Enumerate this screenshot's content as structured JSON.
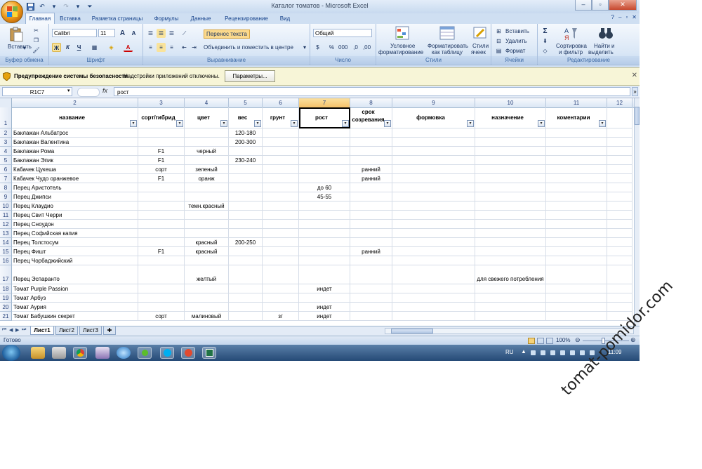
{
  "window": {
    "title": "Каталог томатов - Microsoft Excel",
    "controls": [
      "–",
      "▫",
      "✕"
    ]
  },
  "qat": {
    "items": [
      "save-icon",
      "undo-icon",
      "redo-icon",
      "customize-icon"
    ]
  },
  "tabs": [
    "Главная",
    "Вставка",
    "Разметка страницы",
    "Формулы",
    "Данные",
    "Рецензирование",
    "Вид"
  ],
  "tab_right": {
    "help": "?",
    "min": "–",
    "restore": "▫",
    "close": "✕"
  },
  "ribbon": {
    "clipboard": {
      "label": "Буфер обмена",
      "paste": "Вставить"
    },
    "font": {
      "label": "Шрифт",
      "name": "Calibri",
      "size": "11",
      "bold": "Ж",
      "italic": "К",
      "underline": "Ч",
      "grow": "A",
      "shrink": "A",
      "fontcolor": "A"
    },
    "alignment": {
      "label": "Выравнивание",
      "wrap": "Перенос текста",
      "merge": "Объединить и поместить в центре"
    },
    "number": {
      "label": "Число",
      "format": "Общий",
      "percent": "%",
      "thousands": "000",
      "inc": ",0",
      "dec": ",00"
    },
    "styles": {
      "label": "Стили",
      "conditional_1": "Условное",
      "conditional_2": "форматирование",
      "table_1": "Форматировать",
      "table_2": "как таблицу",
      "cell_1": "Стили",
      "cell_2": "ячеек"
    },
    "cells": {
      "label": "Ячейки",
      "insert": "Вставить",
      "delete": "Удалить",
      "format": "Формат"
    },
    "editing": {
      "label": "Редактирование",
      "sigma": "Σ",
      "sort_1": "Сортировка",
      "sort_2": "и фильтр",
      "find_1": "Найти и",
      "find_2": "выделить"
    }
  },
  "security": {
    "title": "Предупреждение системы безопасности",
    "message": "Надстройки приложений отключены.",
    "button": "Параметры...",
    "close": "✕"
  },
  "formula_bar": {
    "namebox": "R1C7",
    "fx": "fx",
    "value": "рост",
    "expand": "»"
  },
  "grid": {
    "columns": [
      "2",
      "3",
      "4",
      "5",
      "6",
      "7",
      "8",
      "9",
      "10",
      "11",
      "12"
    ],
    "header_row": [
      "название",
      "сорт/гибрид",
      "цвет",
      "вес",
      "грунт",
      "рост",
      "срок созревания",
      "формовка",
      "назначение",
      "коментарии",
      ""
    ],
    "rows": [
      {
        "n": "1"
      },
      {
        "n": "2",
        "cells": [
          "Баклажан Альбатрос",
          "",
          "",
          "120-180",
          "",
          "",
          "",
          "",
          "",
          "",
          ""
        ]
      },
      {
        "n": "3",
        "cells": [
          "Баклажан Валентина",
          "",
          "",
          "200-300",
          "",
          "",
          "",
          "",
          "",
          "",
          ""
        ]
      },
      {
        "n": "4",
        "cells": [
          "Баклажан Рома",
          "F1",
          "черный",
          "",
          "",
          "",
          "",
          "",
          "",
          "",
          ""
        ]
      },
      {
        "n": "5",
        "cells": [
          "Баклажан Эпик",
          "F1",
          "",
          "230-240",
          "",
          "",
          "",
          "",
          "",
          "",
          ""
        ]
      },
      {
        "n": "6",
        "cells": [
          "Кабачек Цукеша",
          "сорт",
          "зеленый",
          "",
          "",
          "",
          "ранний",
          "",
          "",
          "",
          ""
        ]
      },
      {
        "n": "7",
        "cells": [
          "Кабачек Чудо оранжевое",
          "F1",
          "оранж",
          "",
          "",
          "",
          "ранний",
          "",
          "",
          "",
          ""
        ]
      },
      {
        "n": "8",
        "cells": [
          "Перец Аристотель",
          "",
          "",
          "",
          "",
          "до 60",
          "",
          "",
          "",
          "",
          ""
        ]
      },
      {
        "n": "9",
        "cells": [
          "Перец Джипси",
          "",
          "",
          "",
          "",
          "45-55",
          "",
          "",
          "",
          "",
          ""
        ]
      },
      {
        "n": "10",
        "cells": [
          "Перец Клаудио",
          "",
          "темн.красный",
          "",
          "",
          "",
          "",
          "",
          "",
          "",
          ""
        ]
      },
      {
        "n": "11",
        "cells": [
          "Перец Свит Черри",
          "",
          "",
          "",
          "",
          "",
          "",
          "",
          "",
          "",
          ""
        ]
      },
      {
        "n": "12",
        "cells": [
          "Перец Сноудон",
          "",
          "",
          "",
          "",
          "",
          "",
          "",
          "",
          "",
          ""
        ]
      },
      {
        "n": "13",
        "cells": [
          "Перец Софийская капия",
          "",
          "",
          "",
          "",
          "",
          "",
          "",
          "",
          "",
          ""
        ]
      },
      {
        "n": "14",
        "cells": [
          "Перец Толстосум",
          "",
          "красный",
          "200-250",
          "",
          "",
          "",
          "",
          "",
          "",
          ""
        ]
      },
      {
        "n": "15",
        "cells": [
          "Перец Фишт",
          "F1",
          "красный",
          "",
          "",
          "",
          "ранний",
          "",
          "",
          "",
          ""
        ]
      },
      {
        "n": "16",
        "cells": [
          "Перец Чорбаджийский",
          "",
          "",
          "",
          "",
          "",
          "",
          "",
          "",
          "",
          ""
        ]
      },
      {
        "n": "17",
        "cells": [
          "Перец Эспаранто",
          "",
          "желтый",
          "",
          "",
          "",
          "",
          "",
          "для свежего потребления",
          "",
          ""
        ]
      },
      {
        "n": "18",
        "cells": [
          "Томат Purple Passion",
          "",
          "",
          "",
          "",
          "индет",
          "",
          "",
          "",
          "",
          ""
        ]
      },
      {
        "n": "19",
        "cells": [
          "Томат Арбуз",
          "",
          "",
          "",
          "",
          "",
          "",
          "",
          "",
          "",
          ""
        ]
      },
      {
        "n": "20",
        "cells": [
          "Томат Аурия",
          "",
          "",
          "",
          "",
          "индет",
          "",
          "",
          "",
          "",
          ""
        ]
      },
      {
        "n": "21",
        "cells": [
          "Томат Бабушкин секрет",
          "сорт",
          "малиновый",
          "",
          "зг",
          "индет",
          "",
          "",
          "",
          "",
          ""
        ]
      }
    ]
  },
  "sheets": [
    "Лист1",
    "Лист2",
    "Лист3"
  ],
  "status": {
    "ready": "Готово",
    "zoom": "100%"
  },
  "taskbar": {
    "lang": "RU",
    "time": "11:09"
  },
  "watermark": "tomat-pomidor.com",
  "colors": {
    "selected_header": "#f5c26a",
    "ribbon_blue": "#dae7f6",
    "accent": "#15428b"
  }
}
